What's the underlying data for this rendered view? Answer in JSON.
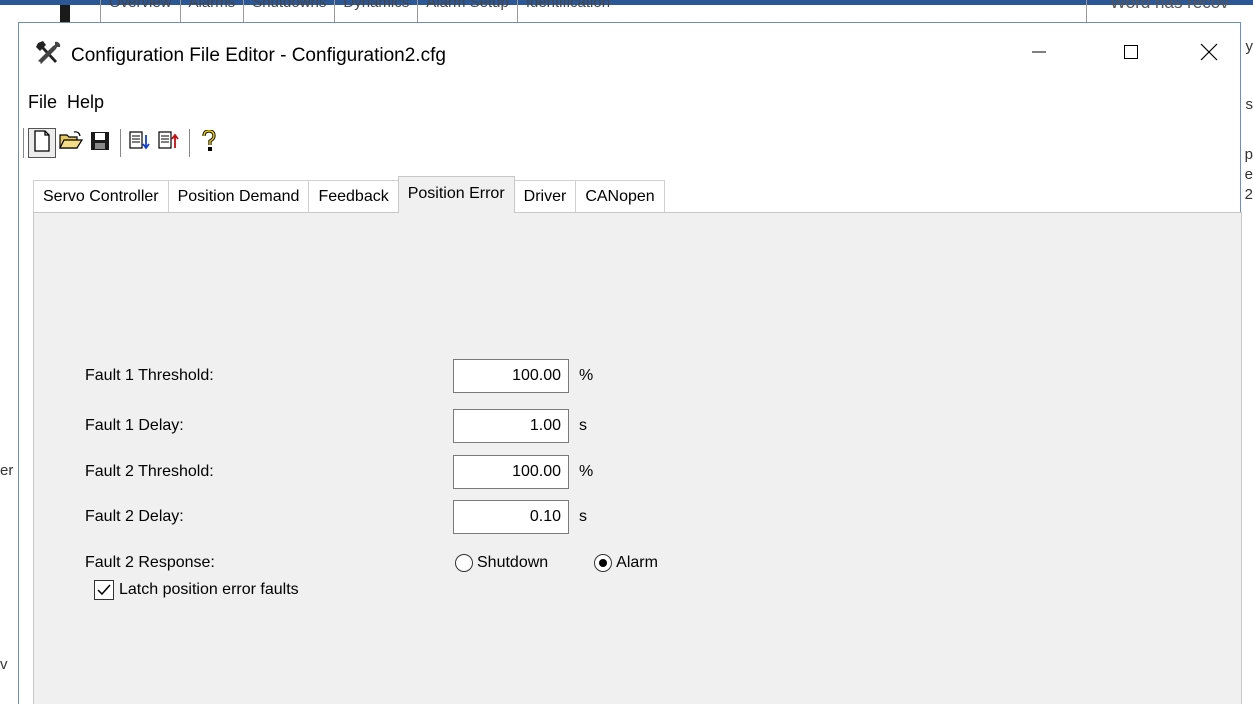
{
  "background": {
    "tabs": [
      "Overview",
      "Alarms",
      "Shutdowns",
      "Dynamics",
      "Alarm Setup",
      "Identification"
    ],
    "word_notice": "Word has recov",
    "right_fragments": [
      "y",
      "s",
      "p",
      "e",
      "2"
    ],
    "left_fragments": [
      "er",
      "v"
    ]
  },
  "window": {
    "title": "Configuration File Editor - Configuration2.cfg",
    "icon": "hammer-wrench-icon",
    "controls": {
      "minimize": "minimize-icon",
      "maximize": "maximize-icon",
      "close": "close-icon"
    }
  },
  "menu": [
    "File",
    "Help"
  ],
  "toolbar": {
    "buttons": [
      {
        "name": "new-file",
        "icon": "new-document-icon"
      },
      {
        "name": "open-file",
        "icon": "open-folder-icon"
      },
      {
        "name": "save-file",
        "icon": "save-disk-icon"
      },
      {
        "name": "import",
        "icon": "import-icon"
      },
      {
        "name": "export",
        "icon": "export-icon"
      },
      {
        "name": "help",
        "icon": "question-mark-icon"
      }
    ]
  },
  "tabs": [
    "Servo Controller",
    "Position Demand",
    "Feedback",
    "Position Error",
    "Driver",
    "CANopen"
  ],
  "active_tab": "Position Error",
  "form": {
    "fault1_threshold": {
      "label": "Fault 1 Threshold:",
      "value": "100.00",
      "unit": "%"
    },
    "fault1_delay": {
      "label": "Fault 1 Delay:",
      "value": "1.00",
      "unit": "s"
    },
    "fault2_threshold": {
      "label": "Fault 2 Threshold:",
      "value": "100.00",
      "unit": "%"
    },
    "fault2_delay": {
      "label": "Fault 2 Delay:",
      "value": "0.10",
      "unit": "s"
    },
    "fault2_response": {
      "label": "Fault 2 Response:",
      "options": [
        "Shutdown",
        "Alarm"
      ],
      "selected": "Alarm"
    },
    "latch": {
      "label": "Latch position error faults",
      "checked": true
    }
  },
  "colors": {
    "window_border": "#6b8ebd",
    "panel_bg": "#f0f0f0",
    "taskbar": "#2b5797"
  }
}
